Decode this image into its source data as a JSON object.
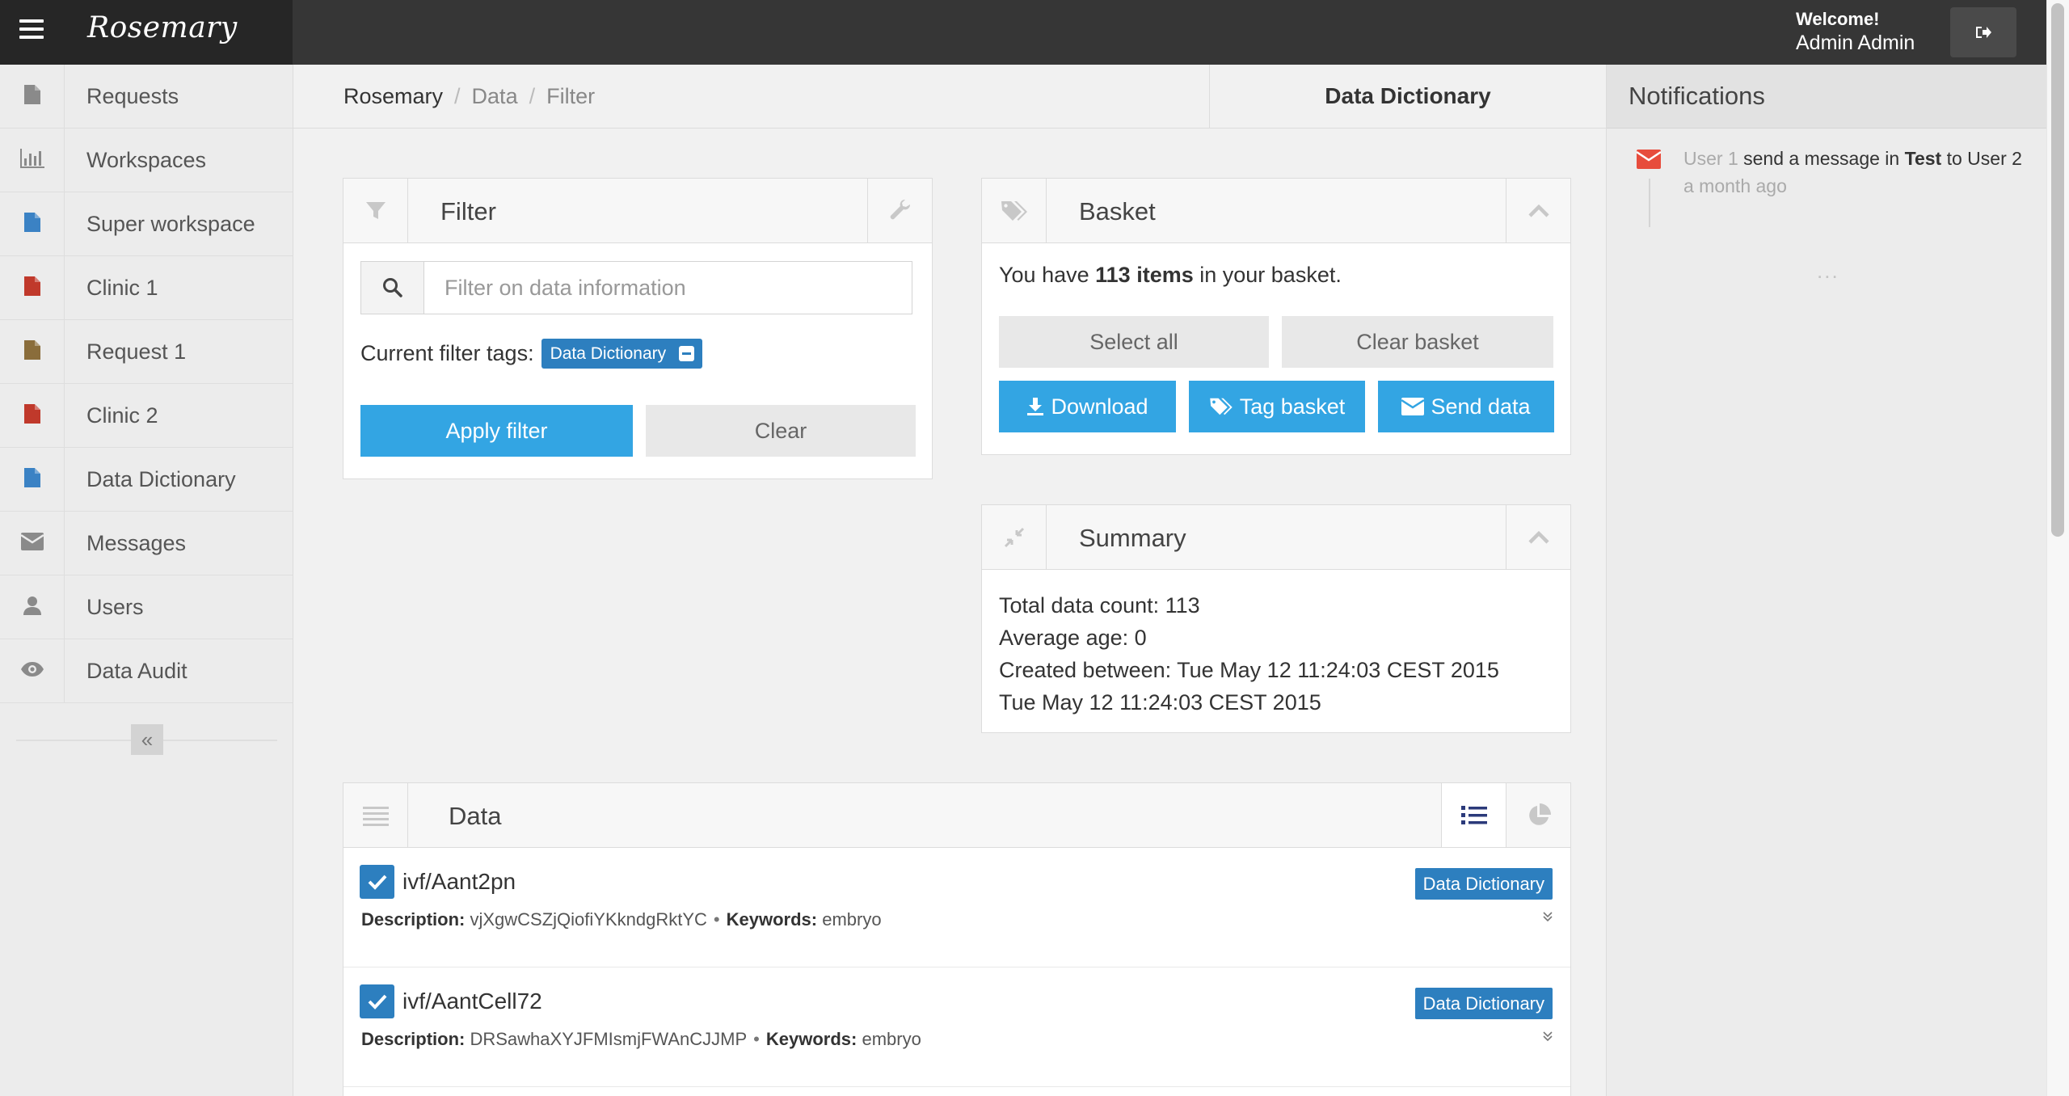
{
  "app": {
    "brand": "Rosemary",
    "welcome_label": "Welcome!",
    "user_name": "Admin Admin"
  },
  "sidebar": {
    "items": [
      {
        "label": "Requests",
        "icon": "file-icon",
        "color": "#8a8a8a"
      },
      {
        "label": "Workspaces",
        "icon": "bar-chart-icon",
        "color": "#8a8a8a"
      },
      {
        "label": "Super workspace",
        "icon": "file-icon",
        "color": "#3b82c4"
      },
      {
        "label": "Clinic 1",
        "icon": "file-icon",
        "color": "#c0392b"
      },
      {
        "label": "Request 1",
        "icon": "file-icon",
        "color": "#8a6d3b"
      },
      {
        "label": "Clinic 2",
        "icon": "file-icon",
        "color": "#c0392b"
      },
      {
        "label": "Data Dictionary",
        "icon": "file-icon",
        "color": "#3b82c4"
      },
      {
        "label": "Messages",
        "icon": "envelope-icon",
        "color": "#8a8a8a"
      },
      {
        "label": "Users",
        "icon": "user-icon",
        "color": "#8a8a8a"
      },
      {
        "label": "Data Audit",
        "icon": "eye-icon",
        "color": "#8a8a8a"
      }
    ],
    "collapse_glyph": "«"
  },
  "breadcrumb": {
    "items": [
      "Rosemary",
      "Data",
      "Filter"
    ],
    "separator": "/"
  },
  "page_title": "Data Dictionary",
  "notifications": {
    "title": "Notifications",
    "items": [
      {
        "sender": "User 1",
        "action": "send a message in",
        "target": "Test",
        "to_word": "to",
        "recipient": "User 2",
        "time": "a month ago"
      }
    ],
    "more": "..."
  },
  "filter_panel": {
    "title": "Filter",
    "search_placeholder": "Filter on data information",
    "current_tags_label": "Current filter tags:",
    "tags": [
      "Data Dictionary"
    ],
    "apply_label": "Apply filter",
    "clear_label": "Clear"
  },
  "basket_panel": {
    "title": "Basket",
    "text_prefix": "You have",
    "text_count": "113 items",
    "text_suffix": "in your basket.",
    "select_all_label": "Select all",
    "clear_basket_label": "Clear basket",
    "download_label": "Download",
    "tag_basket_label": "Tag basket",
    "send_data_label": "Send data"
  },
  "summary_panel": {
    "title": "Summary",
    "lines": [
      "Total data count: 113",
      "Average age: 0",
      "Created between: Tue May 12 11:24:03 CEST 2015",
      "Tue May 12 11:24:03 CEST 2015"
    ]
  },
  "data_panel": {
    "title": "Data",
    "desc_label": "Description:",
    "keywords_label": "Keywords:",
    "rows": [
      {
        "name": "ivf/Aant2pn",
        "tag": "Data Dictionary",
        "description": "vjXgwCSZjQiofiYKkndgRktYC",
        "keywords": "embryo",
        "checked": true
      },
      {
        "name": "ivf/AantCell72",
        "tag": "Data Dictionary",
        "description": "DRSawhaXYJFMIsmjFWAnCJJMP",
        "keywords": "embryo",
        "checked": true
      }
    ]
  },
  "colors": {
    "primary": "#33a5e3",
    "tag_blue": "#2d7fbf",
    "topbar": "#363636",
    "notification_red": "#e74c3c"
  }
}
